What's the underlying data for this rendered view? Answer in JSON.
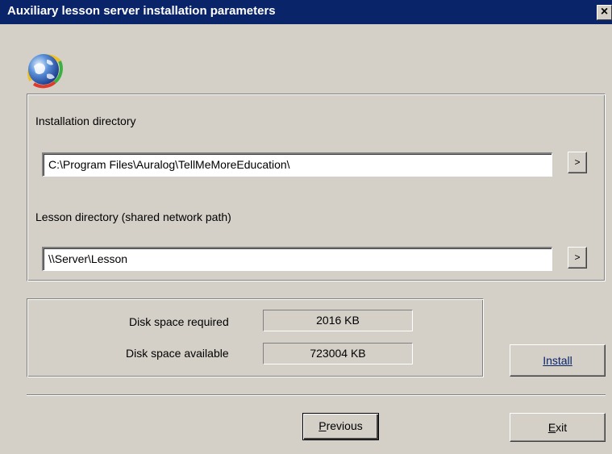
{
  "window": {
    "title": "Auxiliary lesson server installation parameters",
    "close_glyph": "×"
  },
  "installation": {
    "label": "Installation directory",
    "value": "C:\\Program Files\\Auralog\\TellMeMoreEducation\\",
    "browse_label": ">"
  },
  "lesson": {
    "label": "Lesson directory (shared network path)",
    "value": "\\\\Server\\Lesson",
    "browse_label": ">"
  },
  "disk": {
    "required_label": "Disk space required",
    "required_value": "2016 KB",
    "available_label": "Disk space available",
    "available_value": "723004 KB"
  },
  "buttons": {
    "install": "Install",
    "previous": "Previous",
    "exit": "Exit"
  },
  "icons": {
    "app": "globe-icon",
    "close": "close-icon"
  }
}
